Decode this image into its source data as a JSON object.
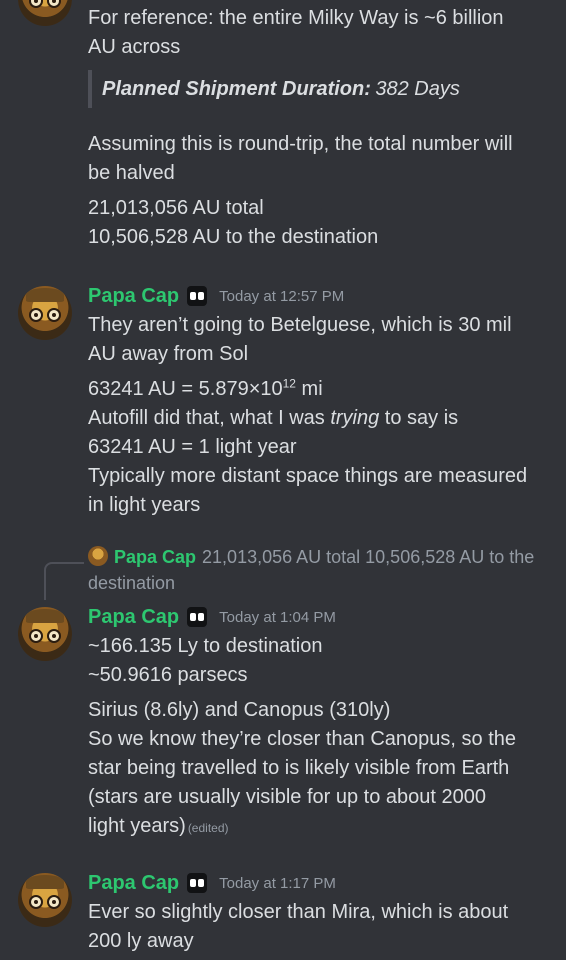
{
  "msg0": {
    "line1": "For reference: the entire Milky Way is ~6 billion",
    "line2": "AU across",
    "quote_bold": "Planned Shipment Duration:",
    "quote_value": "382 Days",
    "para1_l1": "Assuming this is round-trip, the total number will",
    "para1_l2": "be halved",
    "para2_l1": "21,013,056 AU total",
    "para2_l2": "10,506,528 AU to the destination"
  },
  "msg1": {
    "username": "Papa Cap",
    "timestamp": "Today at 12:57 PM",
    "l1": "They aren’t going to Betelguese, which is 30 mil",
    "l2": "AU away from Sol",
    "l3_pre": "63241 AU = 5.879×10",
    "l3_sup": "12",
    "l3_post": " mi",
    "l4_pre": "Autofill did that, what I was ",
    "l4_em": "trying",
    "l4_post": " to say is",
    "l5": "63241 AU = 1 light year",
    "l6": "Typically more distant space things are measured",
    "l7": "in light years"
  },
  "reply": {
    "name": "Papa Cap",
    "text": "21,013,056 AU total 10,506,528 AU to the",
    "text2": "destination"
  },
  "msg2": {
    "username": "Papa Cap",
    "timestamp": "Today at 1:04 PM",
    "l1": "~166.135 Ly to destination",
    "l2": "~50.9616 parsecs",
    "l3": "Sirius (8.6ly) and Canopus (310ly)",
    "l4": "So we know they’re closer than Canopus, so the",
    "l5": "star being travelled to is likely visible from Earth",
    "l6": "(stars are usually visible for up to about 2000",
    "l7": "light years)",
    "edited": "(edited)"
  },
  "msg3": {
    "username": "Papa Cap",
    "timestamp": "Today at 1:17 PM",
    "l1": "Ever so slightly closer than Mira, which is about",
    "l2": "200 ly away"
  },
  "colors": {
    "background": "#313338",
    "username": "#2dc770",
    "text": "#dbdee1",
    "muted": "#949ba4"
  },
  "icons": [
    "avatar",
    "bot-badge-icon"
  ]
}
